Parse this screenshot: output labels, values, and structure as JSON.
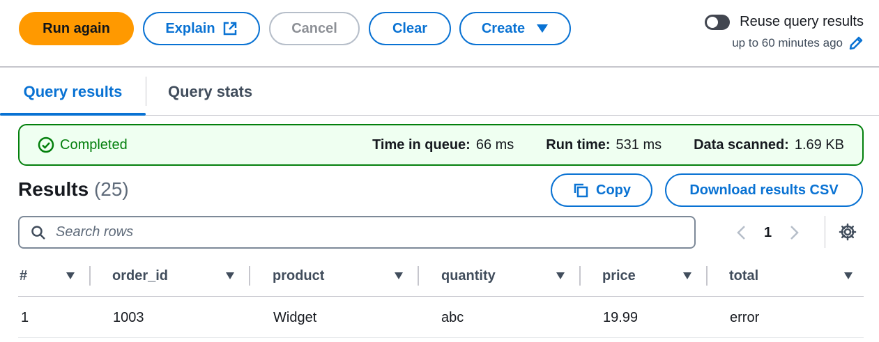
{
  "toolbar": {
    "run_label": "Run again",
    "explain_label": "Explain",
    "cancel_label": "Cancel",
    "clear_label": "Clear",
    "create_label": "Create"
  },
  "reuse": {
    "label": "Reuse query results",
    "sub_label": "up to 60 minutes ago",
    "enabled": false
  },
  "tabs": [
    {
      "label": "Query results",
      "active": true
    },
    {
      "label": "Query stats",
      "active": false
    }
  ],
  "status": {
    "state": "Completed",
    "metrics": [
      {
        "label": "Time in queue:",
        "value": "66 ms"
      },
      {
        "label": "Run time:",
        "value": "531 ms"
      },
      {
        "label": "Data scanned:",
        "value": "1.69 KB"
      }
    ]
  },
  "results": {
    "title": "Results",
    "count": "(25)",
    "copy_label": "Copy",
    "download_label": "Download results CSV"
  },
  "search": {
    "placeholder": "Search rows"
  },
  "pager": {
    "current_page": "1"
  },
  "table": {
    "columns": [
      "#",
      "order_id",
      "product",
      "quantity",
      "price",
      "total"
    ],
    "rows": [
      [
        "1",
        "1003",
        "Widget",
        "abc",
        "19.99",
        "error"
      ]
    ]
  },
  "colors": {
    "primary": "#ff9900",
    "link": "#0972d3",
    "success": "#037f0c",
    "success_bg": "#effff1"
  }
}
